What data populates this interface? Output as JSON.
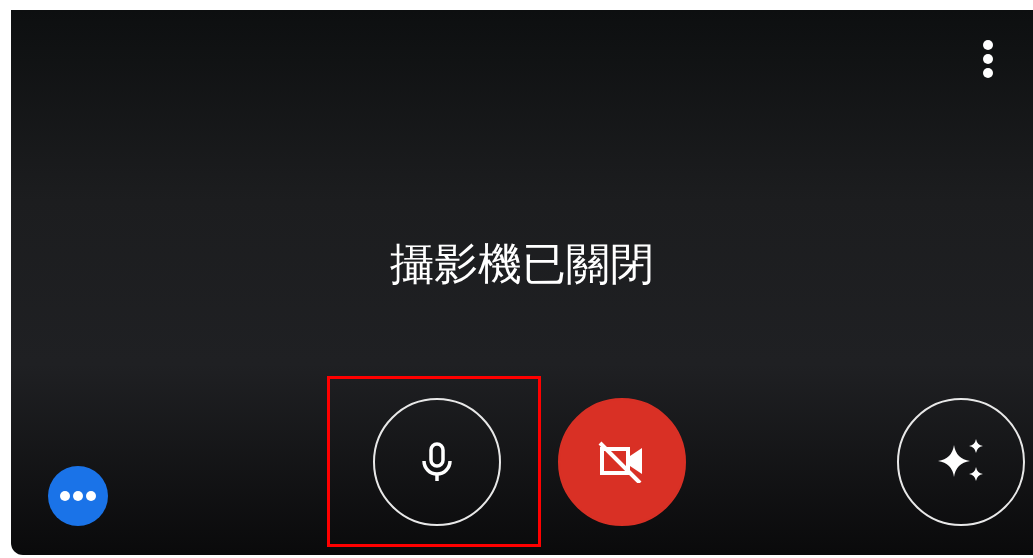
{
  "camera_status": "攝影機已關閉",
  "controls": [
    {
      "kind": "microphone",
      "on": true
    },
    {
      "kind": "camera",
      "on": false
    },
    {
      "kind": "effects"
    }
  ]
}
